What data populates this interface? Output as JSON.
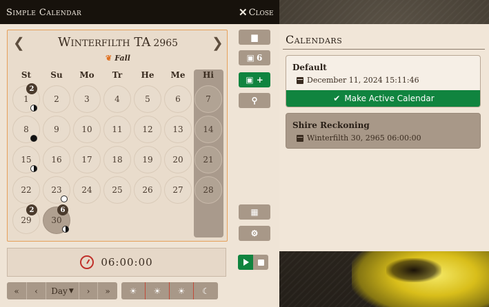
{
  "window": {
    "title": "Simple Calendar",
    "close_label": "Close"
  },
  "month": {
    "name": "Winterfilth TA",
    "year": "2965",
    "season": "Fall",
    "weekdays": [
      "St",
      "Su",
      "Mo",
      "Tr",
      "He",
      "Me",
      "Hi"
    ],
    "days": [
      "1",
      "2",
      "3",
      "4",
      "5",
      "6",
      "7",
      "8",
      "9",
      "10",
      "11",
      "12",
      "13",
      "14",
      "15",
      "16",
      "17",
      "18",
      "19",
      "20",
      "21",
      "22",
      "23",
      "24",
      "25",
      "26",
      "27",
      "28",
      "29",
      "30"
    ],
    "badges": {
      "day1": "2",
      "day29": "2",
      "day30": "6"
    }
  },
  "sidebar_buttons": {
    "notes_count": "6"
  },
  "clock": {
    "time": "06:00:00"
  },
  "time_controls": {
    "unit_label": "Day"
  },
  "calendars_panel": {
    "title": "Calendars",
    "items": [
      {
        "name": "Default",
        "date": "December 11, 2024 15:11:46",
        "action": "Make Active Calendar"
      },
      {
        "name": "Shire Reckoning",
        "date": "Winterfilth 30, 2965 06:00:00"
      }
    ]
  },
  "colors": {
    "accent_green": "#10843f",
    "button_taupe": "#a89888",
    "month_border": "#e6a05a"
  }
}
